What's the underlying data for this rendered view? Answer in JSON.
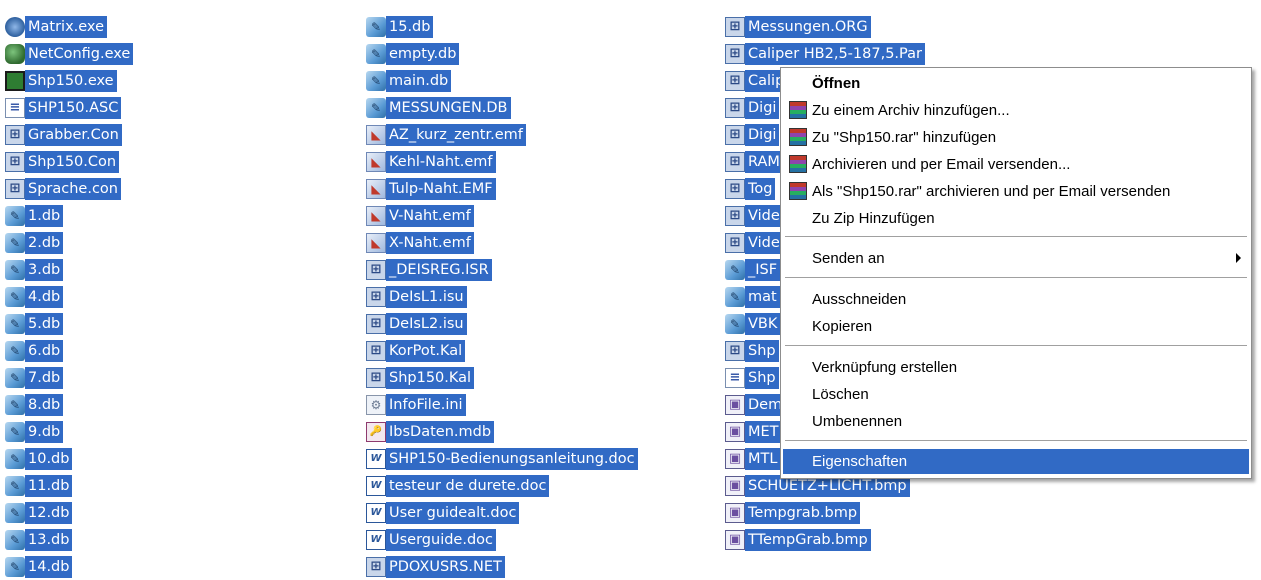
{
  "column1": [
    {
      "name": "Matrix.exe",
      "icon": "exe-matrix"
    },
    {
      "name": "NetConfig.exe",
      "icon": "exe-net"
    },
    {
      "name": "Shp150.exe",
      "icon": "exe-shp"
    },
    {
      "name": "SHP150.ASC",
      "icon": "doc"
    },
    {
      "name": "Grabber.Con",
      "icon": "con"
    },
    {
      "name": "Shp150.Con",
      "icon": "con"
    },
    {
      "name": "Sprache.con",
      "icon": "con"
    },
    {
      "name": "1.db",
      "icon": "db"
    },
    {
      "name": "2.db",
      "icon": "db"
    },
    {
      "name": "3.db",
      "icon": "db"
    },
    {
      "name": "4.db",
      "icon": "db"
    },
    {
      "name": "5.db",
      "icon": "db"
    },
    {
      "name": "6.db",
      "icon": "db"
    },
    {
      "name": "7.db",
      "icon": "db"
    },
    {
      "name": "8.db",
      "icon": "db"
    },
    {
      "name": "9.db",
      "icon": "db"
    },
    {
      "name": "10.db",
      "icon": "db"
    },
    {
      "name": "11.db",
      "icon": "db"
    },
    {
      "name": "12.db",
      "icon": "db"
    },
    {
      "name": "13.db",
      "icon": "db"
    },
    {
      "name": "14.db",
      "icon": "db"
    }
  ],
  "column2": [
    {
      "name": "15.db",
      "icon": "db"
    },
    {
      "name": "empty.db",
      "icon": "db"
    },
    {
      "name": "main.db",
      "icon": "db"
    },
    {
      "name": "MESSUNGEN.DB",
      "icon": "db"
    },
    {
      "name": "AZ_kurz_zentr.emf",
      "icon": "emf"
    },
    {
      "name": "Kehl-Naht.emf",
      "icon": "emf"
    },
    {
      "name": "Tulp-Naht.EMF",
      "icon": "emf"
    },
    {
      "name": "V-Naht.emf",
      "icon": "emf"
    },
    {
      "name": "X-Naht.emf",
      "icon": "emf"
    },
    {
      "name": "_DEISREG.ISR",
      "icon": "con"
    },
    {
      "name": "DeIsL1.isu",
      "icon": "con"
    },
    {
      "name": "DeIsL2.isu",
      "icon": "con"
    },
    {
      "name": "KorPot.Kal",
      "icon": "con"
    },
    {
      "name": "Shp150.Kal",
      "icon": "con"
    },
    {
      "name": "InfoFile.ini",
      "icon": "ini"
    },
    {
      "name": "IbsDaten.mdb",
      "icon": "mdb"
    },
    {
      "name": "SHP150-Bedienungsanleitung.doc",
      "icon": "word"
    },
    {
      "name": "testeur de durete.doc",
      "icon": "word"
    },
    {
      "name": "User guidealt.doc",
      "icon": "word"
    },
    {
      "name": "Userguide.doc",
      "icon": "word"
    },
    {
      "name": "PDOXUSRS.NET",
      "icon": "con"
    }
  ],
  "column3": [
    {
      "name": "Messungen.ORG",
      "icon": "con"
    },
    {
      "name": "Caliper HB2,5-187,5.Par",
      "icon": "con"
    },
    {
      "name": "Calip",
      "icon": "con"
    },
    {
      "name": "Digi",
      "icon": "con"
    },
    {
      "name": "Digi",
      "icon": "con"
    },
    {
      "name": "RAM",
      "icon": "con"
    },
    {
      "name": "Tog",
      "icon": "con"
    },
    {
      "name": "Vide",
      "icon": "con"
    },
    {
      "name": "Vide",
      "icon": "con"
    },
    {
      "name": "_ISF",
      "icon": "db"
    },
    {
      "name": "mat",
      "icon": "db"
    },
    {
      "name": "VBK",
      "icon": "db"
    },
    {
      "name": "Shp",
      "icon": "con"
    },
    {
      "name": "Shp",
      "icon": "doc"
    },
    {
      "name": "Dem",
      "icon": "bmp"
    },
    {
      "name": "MET",
      "icon": "bmp"
    },
    {
      "name": "MTL",
      "icon": "bmp"
    },
    {
      "name": "SCHUETZ+LICHT.bmp",
      "icon": "bmp"
    },
    {
      "name": "Tempgrab.bmp",
      "icon": "bmp"
    },
    {
      "name": "TTempGrab.bmp",
      "icon": "bmp"
    }
  ],
  "context_menu": {
    "open": "Öffnen",
    "add_archive": "Zu einem Archiv hinzufügen...",
    "add_rar": "Zu \"Shp150.rar\" hinzufügen",
    "archive_email": "Archivieren und per Email versenden...",
    "archive_rar_email": "Als \"Shp150.rar\" archivieren und per Email versenden",
    "add_zip": "Zu Zip Hinzufügen",
    "send_to": "Senden an",
    "cut": "Ausschneiden",
    "copy": "Kopieren",
    "create_shortcut": "Verknüpfung erstellen",
    "delete": "Löschen",
    "rename": "Umbenennen",
    "properties": "Eigenschaften"
  },
  "colors": {
    "selection": "#316ac5"
  }
}
